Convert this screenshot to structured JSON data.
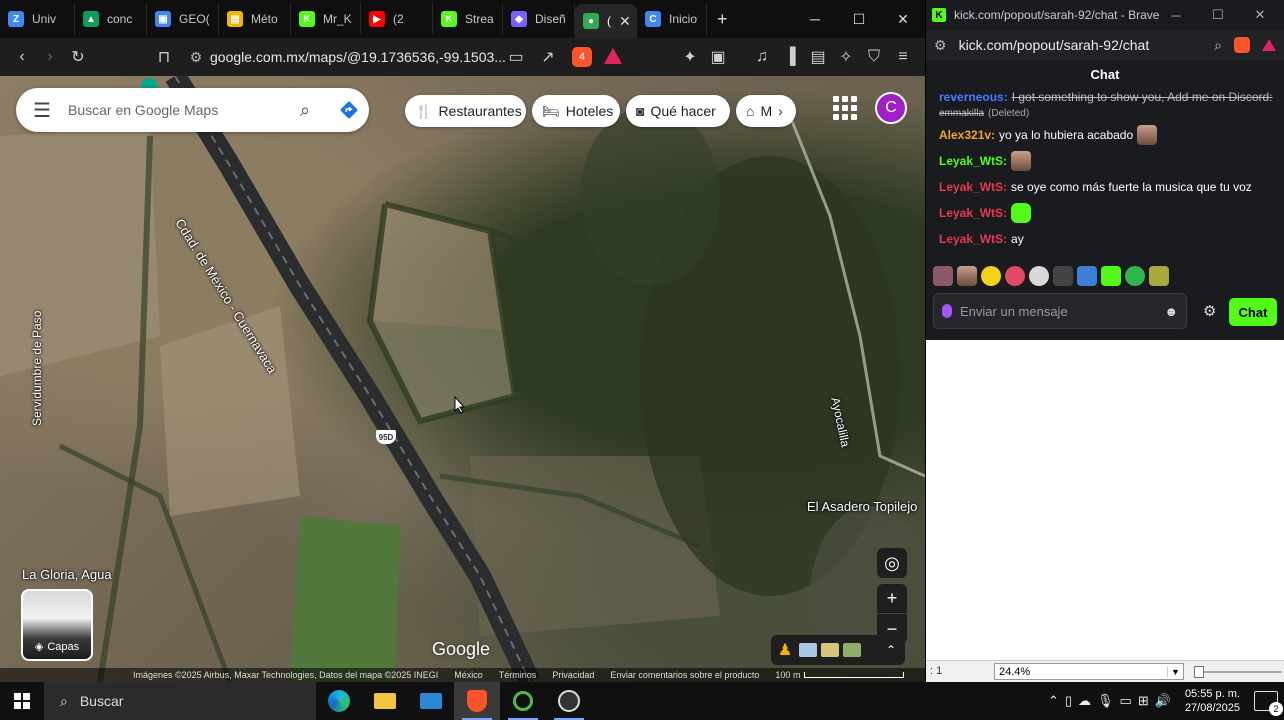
{
  "browser": {
    "tabs": [
      {
        "label": "Univ",
        "fav_color": "#4285f4",
        "fav_glyph": "Z"
      },
      {
        "label": "conc",
        "fav_color": "#0f9d58",
        "fav_glyph": "▲"
      },
      {
        "label": "GEO(",
        "fav_color": "#4285f4",
        "fav_glyph": "▣"
      },
      {
        "label": "Méto",
        "fav_color": "#f4b400",
        "fav_glyph": "▤"
      },
      {
        "label": "Mr_K",
        "fav_color": "#53fc18",
        "fav_glyph": "K"
      },
      {
        "label": "(2",
        "fav_color": "#ff0000",
        "fav_glyph": "▶"
      },
      {
        "label": "Strea",
        "fav_color": "#53fc18",
        "fav_glyph": "K"
      },
      {
        "label": "Diseñ",
        "fav_color": "#7b61ff",
        "fav_glyph": "◆"
      },
      {
        "label": "(",
        "fav_color": "#34a853",
        "fav_glyph": "●"
      },
      {
        "label": "Inicio",
        "fav_color": "#4285f4",
        "fav_glyph": "C"
      }
    ],
    "url": "google.com.mx/maps/@19.1736536,-99.1503...",
    "brave_badge": "4"
  },
  "map": {
    "search_placeholder": "Buscar en Google Maps",
    "chips": [
      "Restaurantes",
      "Hoteles",
      "Qué hacer",
      "M"
    ],
    "avatar_letter": "C",
    "labels": {
      "road": "Cdad. de México - Cuernavaca",
      "ayocalilla": "Ayocalilla",
      "servidumbre": "Servidumbre de Paso",
      "asadero": "El Asadero Topilejo",
      "gloria": "La Gloria, Agua",
      "shield": "95D"
    },
    "layers_label": "Capas",
    "google_logo": "Google",
    "attribution": {
      "imagery": "Imágenes ©2025 Airbus, Maxar Technologies, Datos del mapa ©2025 INEGI",
      "country": "México",
      "terms": "Términos",
      "privacy": "Privacidad",
      "feedback": "Enviar comentarios sobre el producto",
      "scale": "100 m"
    }
  },
  "kick": {
    "window_title": "kick.com/popout/sarah-92/chat - Brave",
    "url": "kick.com/popout/sarah-92/chat",
    "chat_header": "Chat",
    "messages": [
      {
        "user": "reverneous:",
        "text": "I got something to show you, Add me on Discord:",
        "user_color": "#4a7bff",
        "deleted": true
      },
      {
        "user": "",
        "text": "emmakilla",
        "suffix": "(Deleted)",
        "user_color": "#ffffff",
        "deleted": true
      },
      {
        "user": "Alex321v:",
        "text": "yo ya lo hubiera acabado",
        "user_color": "#f5a623",
        "deleted": false
      },
      {
        "user": "Leyak_WtS:",
        "text": "",
        "user_color": "#53fc18",
        "deleted": false
      },
      {
        "user": "Leyak_WtS:",
        "text": "se oye como más fuerte la musica que tu voz",
        "user_color": "#e53950",
        "deleted": false
      },
      {
        "user": "Leyak_WtS:",
        "text": "",
        "user_color": "#e53950",
        "deleted": false
      },
      {
        "user": "Leyak_WtS:",
        "text": "ay",
        "user_color": "#e53950",
        "deleted": false
      }
    ],
    "input_placeholder": "Enviar un mensaje",
    "send_label": "Chat"
  },
  "viewer": {
    "left_text": ": 1",
    "zoom_value": "24.4%"
  },
  "taskbar": {
    "search_label": "Buscar",
    "time": "05:55 p. m.",
    "date": "27/08/2025",
    "notifications": "2"
  }
}
